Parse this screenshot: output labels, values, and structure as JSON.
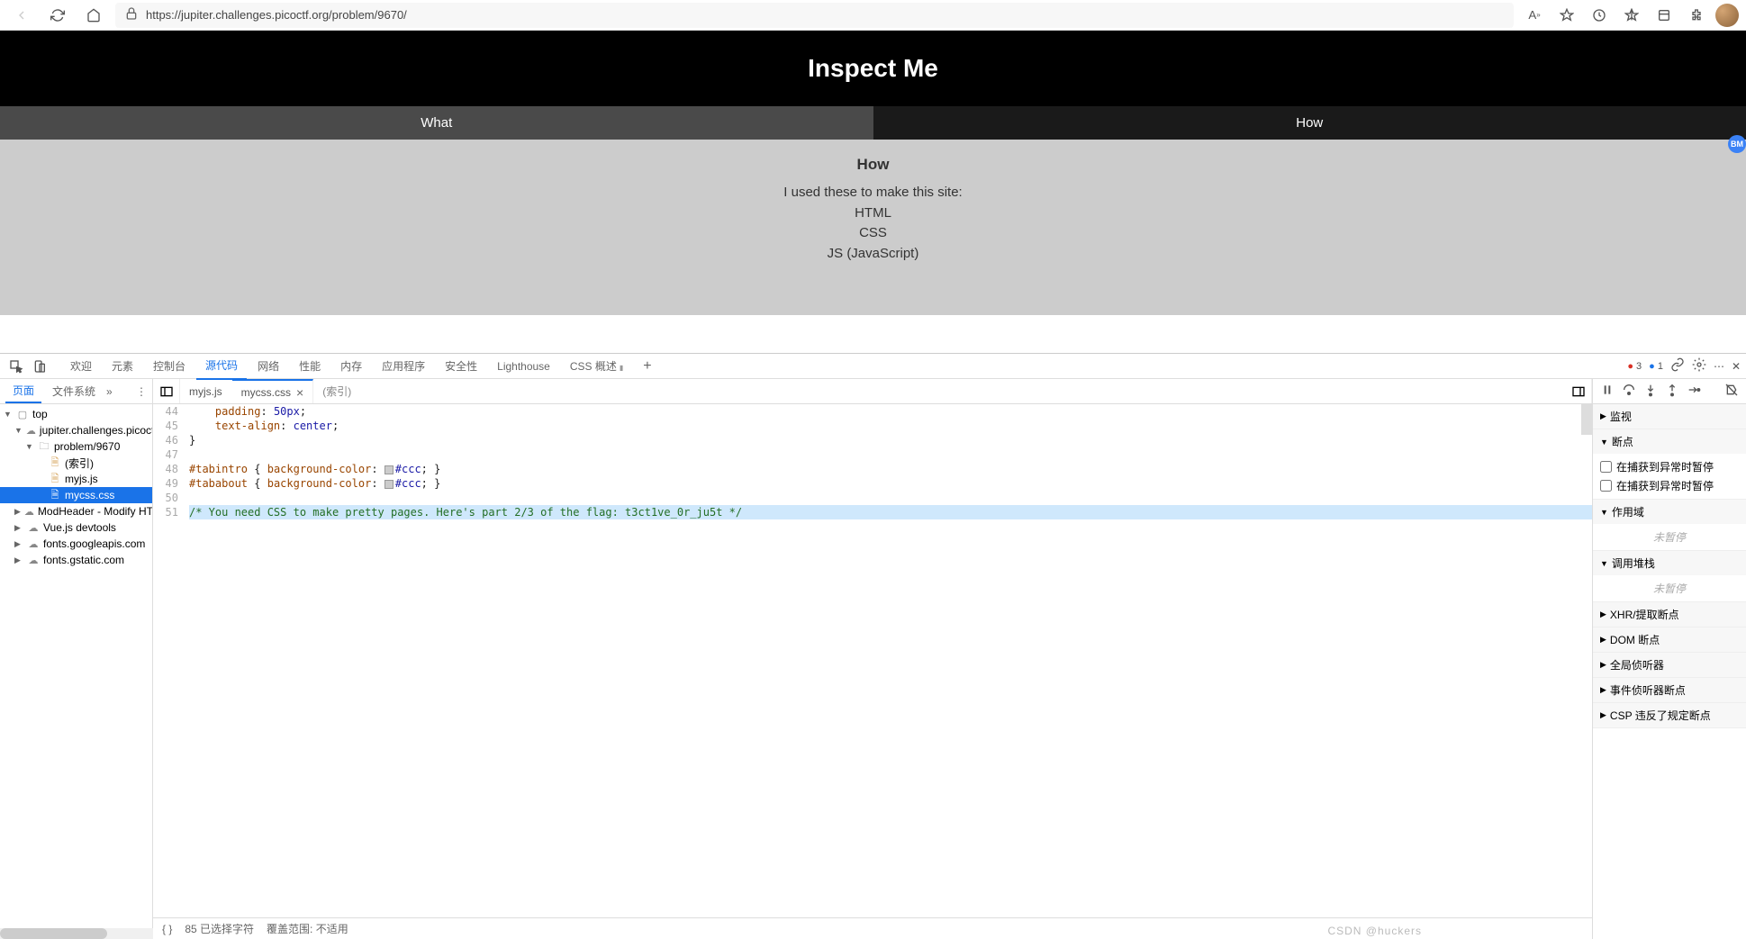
{
  "browser": {
    "url": "https://jupiter.challenges.picoctf.org/problem/9670/"
  },
  "page": {
    "title": "Inspect Me",
    "tabs": {
      "what": "What",
      "how": "How"
    },
    "content": {
      "heading": "How",
      "intro": "I used these to make this site:",
      "line1": "HTML",
      "line2": "CSS",
      "line3": "JS (JavaScript)"
    },
    "badge": "BM"
  },
  "devtools": {
    "tabs": [
      "欢迎",
      "元素",
      "控制台",
      "源代码",
      "网络",
      "性能",
      "内存",
      "应用程序",
      "安全性",
      "Lighthouse",
      "CSS 概述"
    ],
    "activeTab": "源代码",
    "errCount": "3",
    "infoCount": "1",
    "leftTabs": {
      "page": "页面",
      "fs": "文件系统"
    },
    "fileTree": {
      "top": "top",
      "domain": "jupiter.challenges.picoctf.org",
      "problem": "problem/9670",
      "index": "(索引)",
      "myjs": "myjs.js",
      "mycss": "mycss.css",
      "ext1": "ModHeader - Modify HTTP hea",
      "ext2": "Vue.js devtools",
      "ext3": "fonts.googleapis.com",
      "ext4": "fonts.gstatic.com"
    },
    "editor": {
      "tab1": "myjs.js",
      "tab2": "mycss.css",
      "breadcrumb": "(索引)",
      "lines": [
        "44",
        "45",
        "46",
        "47",
        "48",
        "49",
        "50",
        "51"
      ],
      "code": {
        "l44a": "    padding",
        "l44b": ": ",
        "l44c": "50px",
        "l44d": ";",
        "l45a": "    text-align",
        "l45b": ": ",
        "l45c": "center",
        "l45d": ";",
        "l46": "}",
        "l48a": "#tabintro",
        "l48b": " { ",
        "l48c": "background-color",
        "l48d": ": ",
        "l48e": "#ccc",
        "l48f": "; }",
        "l49a": "#tababout",
        "l49b": " { ",
        "l49c": "background-color",
        "l49d": ": ",
        "l49e": "#ccc",
        "l49f": "; }",
        "l51": "/* You need CSS to make pretty pages. Here's part 2/3 of the flag: t3ct1ve_0r_ju5t */"
      }
    },
    "status": {
      "braces": "{ }",
      "sel": "85 已选择字符",
      "cov": "覆盖范围: 不适用"
    },
    "debugger": {
      "watch": "监视",
      "breakpoints": "断点",
      "bp1": "在捕获到异常时暂停",
      "bp2": "在捕获到异常时暂停",
      "scope": "作用域",
      "paused1": "未暂停",
      "callstack": "调用堆栈",
      "paused2": "未暂停",
      "xhr": "XHR/提取断点",
      "dom": "DOM 断点",
      "global": "全局侦听器",
      "event": "事件侦听器断点",
      "csp": "CSP 违反了规定断点"
    }
  },
  "watermark": "CSDN @huckers"
}
